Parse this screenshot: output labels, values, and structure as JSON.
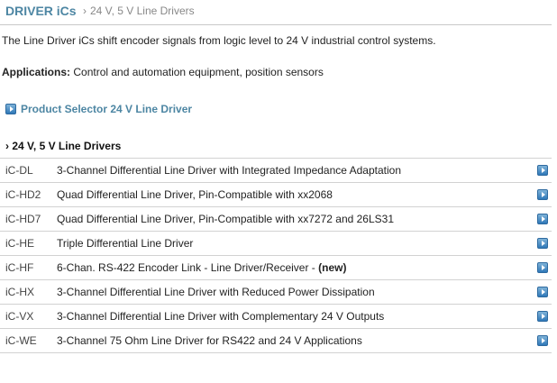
{
  "header": {
    "title": "DRIVER iCs",
    "separator": "›",
    "breadcrumb": "24 V, 5 V Line Drivers"
  },
  "intro": "The Line Driver iCs shift encoder signals from logic level to 24 V industrial control systems.",
  "applications": {
    "label": "Applications:",
    "text": " Control and automation equipment, position sensors"
  },
  "selector_link": "Product Selector 24 V Line Driver",
  "section_title": "› 24 V, 5 V Line Drivers",
  "products": [
    {
      "code": "iC-DL",
      "desc": "3-Channel Differential Line Driver with Integrated Impedance Adaptation",
      "tag": ""
    },
    {
      "code": "iC-HD2",
      "desc": "Quad Differential Line Driver, Pin-Compatible with xx2068",
      "tag": ""
    },
    {
      "code": "iC-HD7",
      "desc": "Quad Differential Line Driver, Pin-Compatible with xx7272 and 26LS31",
      "tag": ""
    },
    {
      "code": "iC-HE",
      "desc": "Triple Differential Line Driver",
      "tag": ""
    },
    {
      "code": "iC-HF",
      "desc": "6-Chan. RS-422 Encoder Link - Line Driver/Receiver - ",
      "tag": "(new)"
    },
    {
      "code": "iC-HX",
      "desc": "3-Channel Differential Line Driver with Reduced Power Dissipation",
      "tag": ""
    },
    {
      "code": "iC-VX",
      "desc": "3-Channel Differential Line Driver with Complementary 24 V Outputs",
      "tag": ""
    },
    {
      "code": "iC-WE",
      "desc": "3-Channel 75 Ohm Line Driver for RS422 and 24 V Applications",
      "tag": ""
    }
  ],
  "icons": {
    "link_arrow": "arrow-right-icon"
  },
  "colors": {
    "accent": "#4d86a3",
    "icon_blue": "#2f78b8",
    "divider": "#d2d2d2"
  }
}
